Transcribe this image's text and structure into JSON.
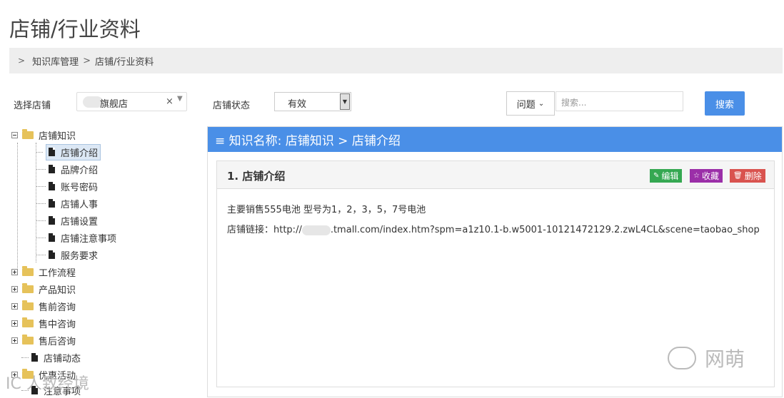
{
  "page": {
    "title": "店铺/行业资料"
  },
  "breadcrumb": {
    "items": [
      "知识库管理",
      "店铺/行业资料"
    ],
    "separator": ">"
  },
  "filters": {
    "shop_label": "选择店铺",
    "shop_value": "旗舰店",
    "shop_clear": "×",
    "status_label": "店铺状态",
    "status_value": "有效",
    "search_type": "问题",
    "search_placeholder": "搜索...",
    "search_button": "搜索"
  },
  "tree": {
    "root": "店铺知识",
    "children": [
      "店铺介绍",
      "品牌介绍",
      "账号密码",
      "店铺人事",
      "店铺设置",
      "店铺注意事项",
      "服务要求"
    ],
    "folders": [
      "工作流程",
      "产品知识",
      "售前咨询",
      "售中咨询",
      "售后咨询"
    ],
    "docs": [
      "店铺动态"
    ],
    "more_folders": [
      "优惠活动"
    ],
    "more_docs": [
      "注意事项"
    ]
  },
  "panel": {
    "header": "≡ 知识名称: 店铺知识 > 店铺介绍",
    "card_title": "1. 店铺介绍",
    "actions": {
      "edit": "编辑",
      "fav": "收藏",
      "del": "删除"
    },
    "line1": "主要销售555电池 型号为1，2，3，5，7号电池",
    "line2_prefix": "店铺链接：http://",
    "line2_suffix": ".tmall.com/index.htm?spm=a1z10.1-b.w5001-10121472129.2.zwL4CL&scene=taobao_shop"
  },
  "watermark": {
    "right": "网萌",
    "left": "IC 人致经境"
  },
  "colors": {
    "accent": "#4a8fe7",
    "edit": "#35a852",
    "fav": "#9b2fa8",
    "del": "#d9534f"
  }
}
